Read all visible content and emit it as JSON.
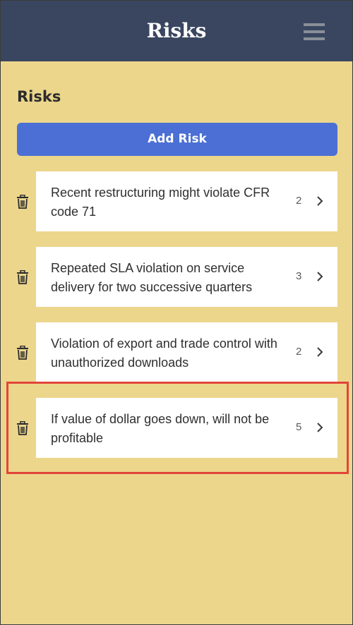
{
  "header": {
    "title": "Risks",
    "menu_icon": "hamburger-menu-icon"
  },
  "main": {
    "heading": "Risks",
    "add_button_label": "Add Risk",
    "risks": [
      {
        "text": "Recent restructuring might violate CFR code 71",
        "count": "2"
      },
      {
        "text": "Repeated SLA violation on service delivery for two successive quarters",
        "count": "3"
      },
      {
        "text": "Violation of export and trade control with unauthorized downloads",
        "count": "2"
      },
      {
        "text": "If value of dollar goes down, will not be profitable",
        "count": "5"
      }
    ]
  },
  "colors": {
    "header_bg": "#3a4660",
    "page_bg": "#ecd68c",
    "button_bg": "#4b6fd4",
    "highlight": "#e1453a"
  }
}
